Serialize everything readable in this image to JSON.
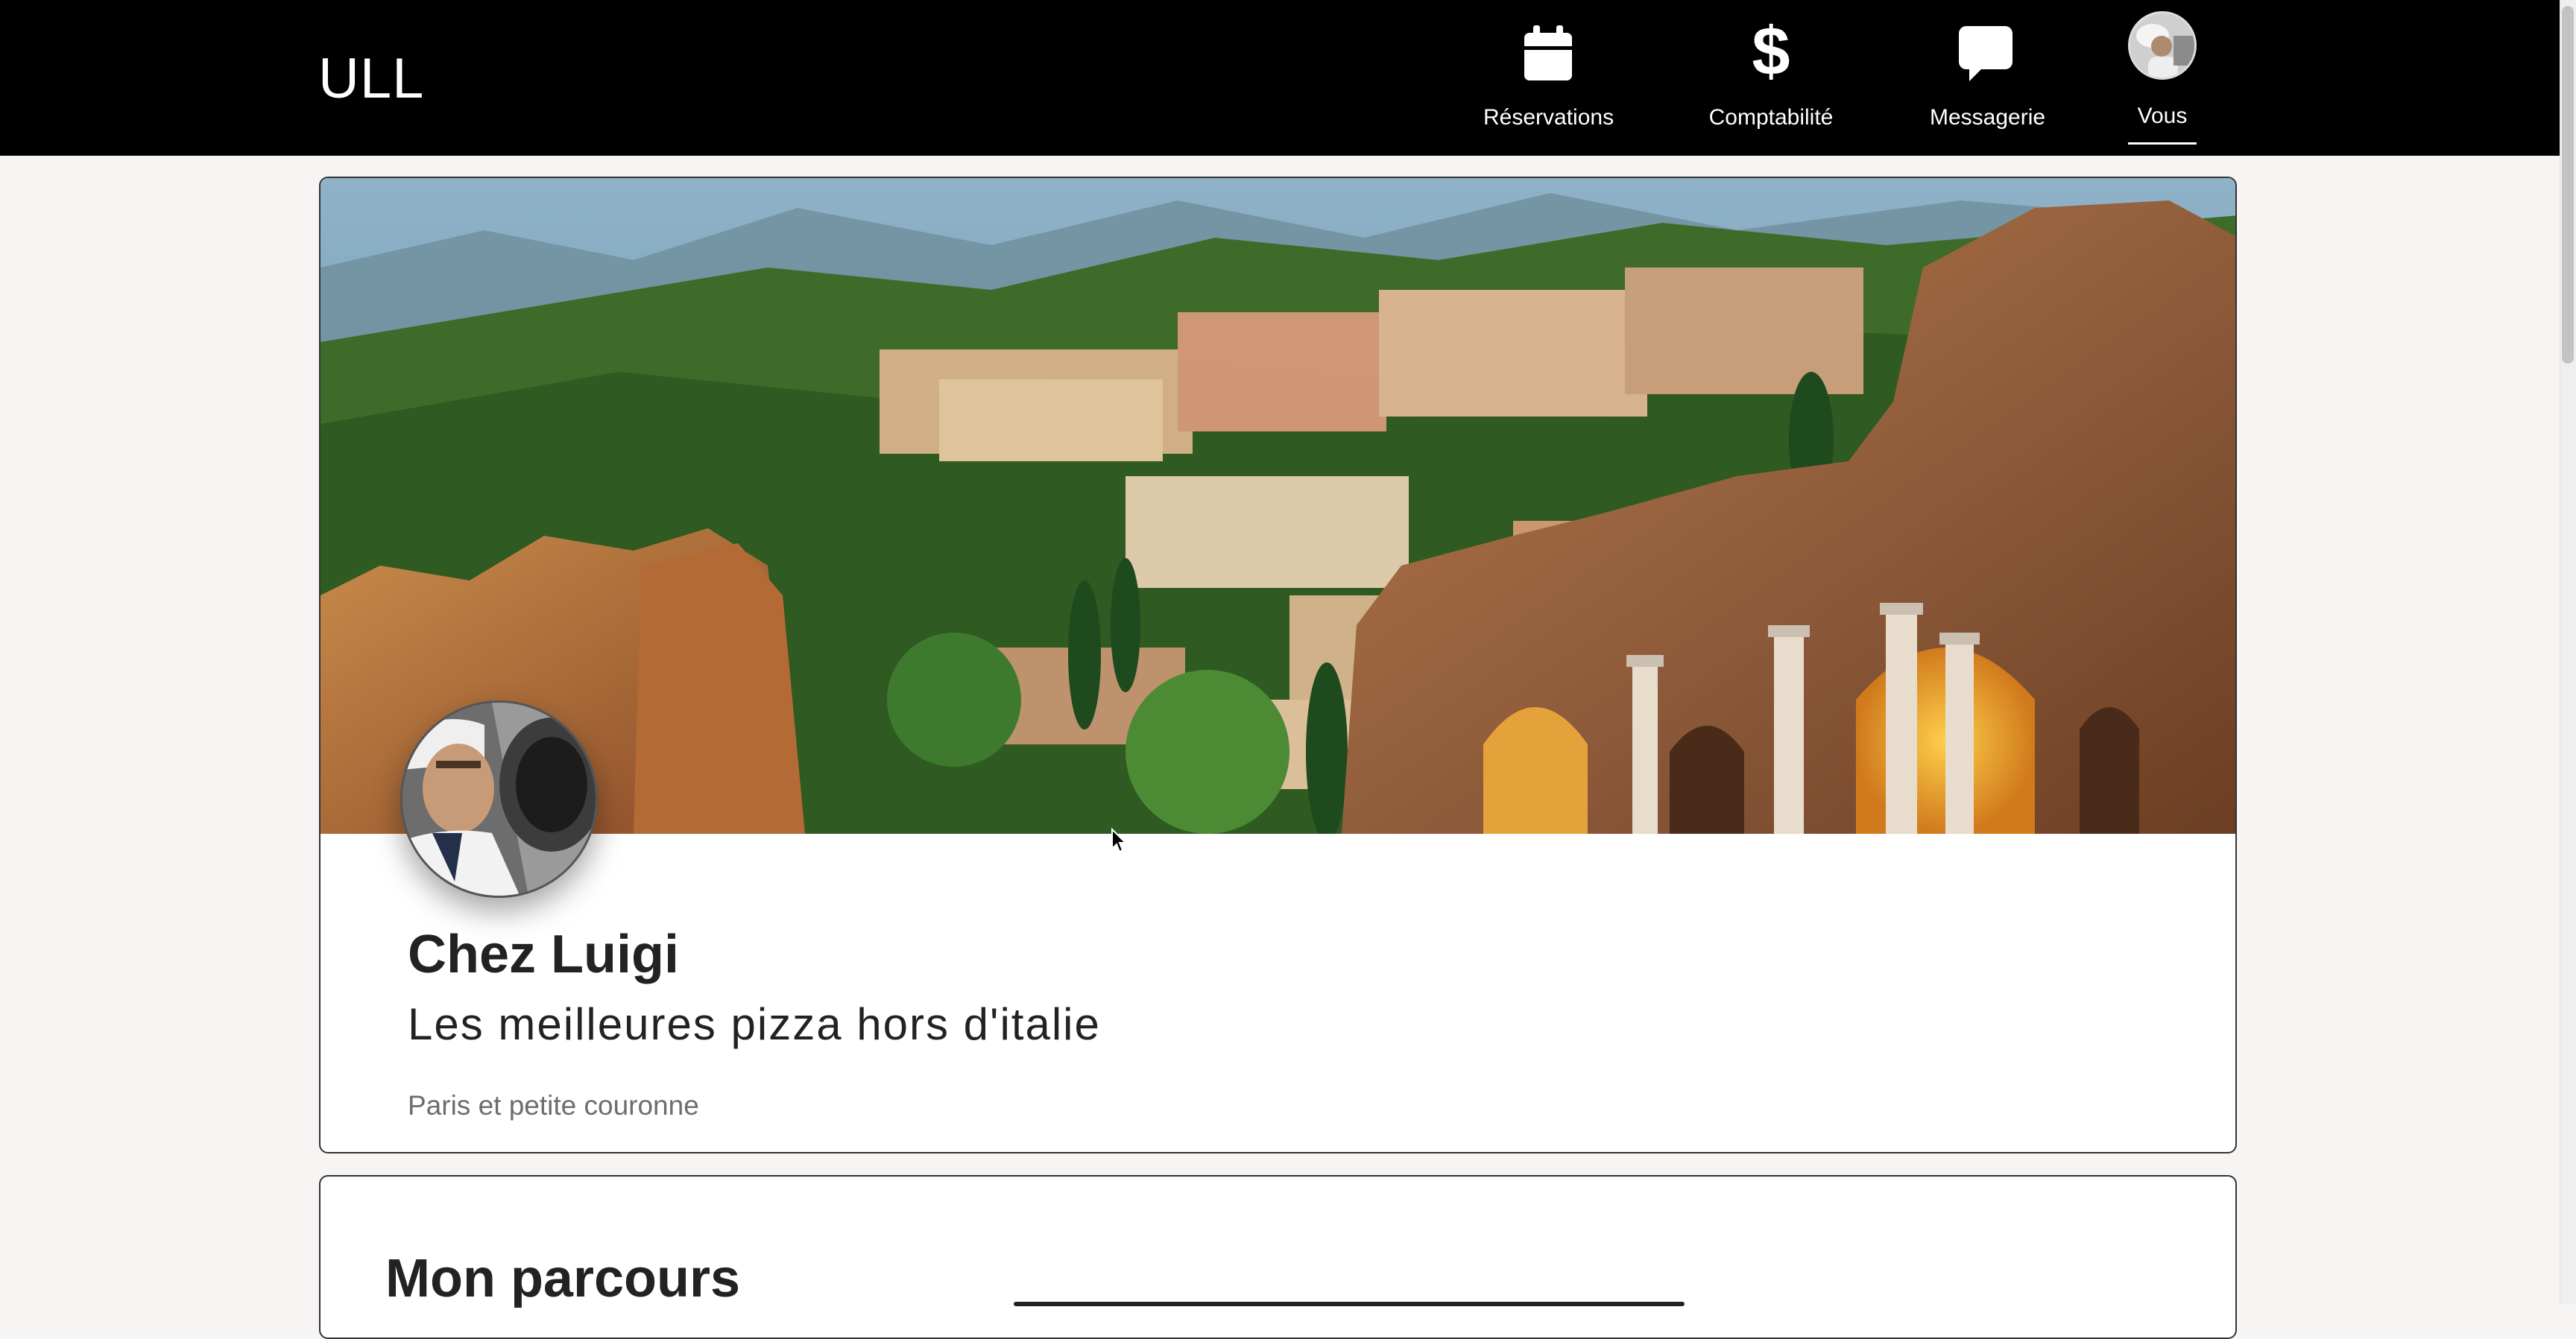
{
  "brand": "ULL",
  "nav": {
    "reservations": {
      "label": "Réservations",
      "icon": "calendar-icon"
    },
    "comptabilite": {
      "label": "Comptabilité",
      "icon": "dollar-icon"
    },
    "messagerie": {
      "label": "Messagerie",
      "icon": "chat-bubble-icon"
    },
    "vous": {
      "label": "Vous",
      "icon": "user-avatar",
      "active": true
    }
  },
  "profile": {
    "name": "Chez Luigi",
    "tagline": "Les meilleures pizza hors d'italie",
    "location": "Paris et petite couronne"
  },
  "sections": {
    "parcours_title": "Mon parcours"
  },
  "colors": {
    "nav_background": "#000000",
    "page_background": "#f7f5f4",
    "card_border": "#333333",
    "text_primary": "#222222",
    "text_muted": "#6d6d6d"
  }
}
